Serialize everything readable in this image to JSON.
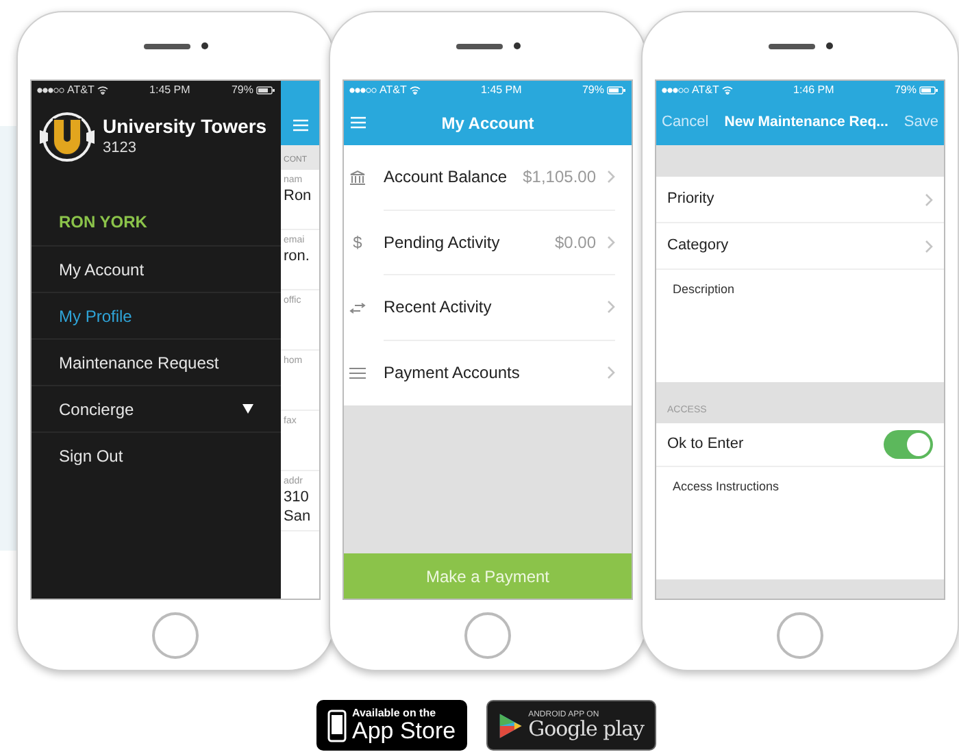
{
  "phones": [
    {
      "kind": "menu",
      "status": {
        "carrier": "AT&T",
        "time": "1:45 PM",
        "battery": "79%"
      },
      "brand": {
        "title": "University Towers",
        "unit": "3123"
      },
      "user": "RON YORK",
      "items": [
        {
          "label": "My Account",
          "selected": false,
          "kind": "link"
        },
        {
          "label": "My Profile",
          "selected": true,
          "kind": "link"
        },
        {
          "label": "Maintenance Request",
          "selected": false,
          "kind": "link"
        },
        {
          "label": "Concierge",
          "selected": false,
          "kind": "expandable"
        },
        {
          "label": "Sign Out",
          "selected": false,
          "kind": "link"
        }
      ],
      "peek": {
        "section": "CONT",
        "fields": [
          {
            "label": "nam",
            "lines": [
              "Ron"
            ]
          },
          {
            "label": "emai",
            "lines": [
              "ron."
            ]
          },
          {
            "label": "offic"
          },
          {
            "label": "hom"
          },
          {
            "label": "fax"
          },
          {
            "label": "addr",
            "lines": [
              "310",
              "San"
            ]
          }
        ]
      }
    },
    {
      "kind": "account",
      "status": {
        "carrier": "AT&T",
        "time": "1:45 PM",
        "battery": "79%"
      },
      "title": "My Account",
      "rows": [
        {
          "kind": "bank",
          "label": "Account Balance",
          "value": "$1,105.00"
        },
        {
          "kind": "dollar",
          "symbol": "$",
          "label": "Pending Activity",
          "value": "$0.00"
        },
        {
          "kind": "arrows",
          "label": "Recent Activity"
        },
        {
          "kind": "list",
          "label": "Payment Accounts"
        }
      ],
      "button": "Make a Payment"
    },
    {
      "kind": "form",
      "status": {
        "carrier": "AT&T",
        "time": "1:46 PM",
        "battery": "79%"
      },
      "cancel": "Cancel",
      "title": "New Maintenance Req...",
      "save": "Save",
      "pickers": [
        "Priority",
        "Category"
      ],
      "description": "Description",
      "section": "ACCESS",
      "toggle": {
        "label": "Ok to Enter",
        "on": true
      },
      "instructions": "Access Instructions"
    }
  ],
  "badges": [
    {
      "kind": "apple",
      "small": "Available on the",
      "big": "App Store"
    },
    {
      "kind": "google",
      "small": "ANDROID APP ON",
      "big": "Google play"
    }
  ]
}
